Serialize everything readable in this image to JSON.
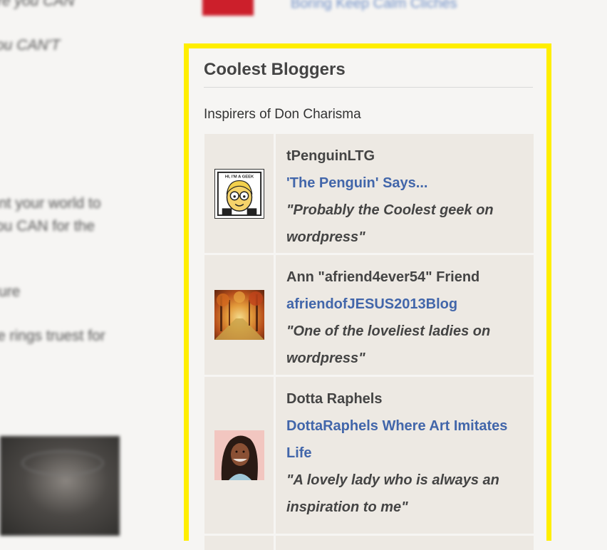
{
  "background": {
    "left_fragments": [
      "re you CAN",
      "ou CAN'T",
      "nt your world to",
      "ou CAN for the",
      "ure",
      "e rings truest for"
    ],
    "top_link": "Boring Keep Calm Clichés",
    "colors": {
      "thumb": "#cc1f2b",
      "link": "#4266aa"
    }
  },
  "widget": {
    "title": "Coolest Bloggers",
    "subtitle": "Inspirers of Don Charisma",
    "highlight_color": "#ffee00",
    "bloggers": [
      {
        "name": "tPenguinLTG",
        "blog": "'The Penguin' Says...",
        "quote": "\"Probably the Coolest geek on wordpress\"",
        "avatar_icon": "geek-cartoon-avatar",
        "avatar_text": "HI, I'M A GEEK"
      },
      {
        "name": "Ann \"afriend4ever54\" Friend",
        "blog": "afriendofJESUS2013Blog",
        "quote": "\"One of the loveliest ladies on wordpress\"",
        "avatar_icon": "autumn-forest-avatar"
      },
      {
        "name": "Dotta Raphels",
        "blog": "DottaRaphels Where Art Imitates Life",
        "quote": "\"A lovely lady who is always an inspiration to me\"",
        "avatar_icon": "woman-portrait-avatar"
      }
    ]
  }
}
